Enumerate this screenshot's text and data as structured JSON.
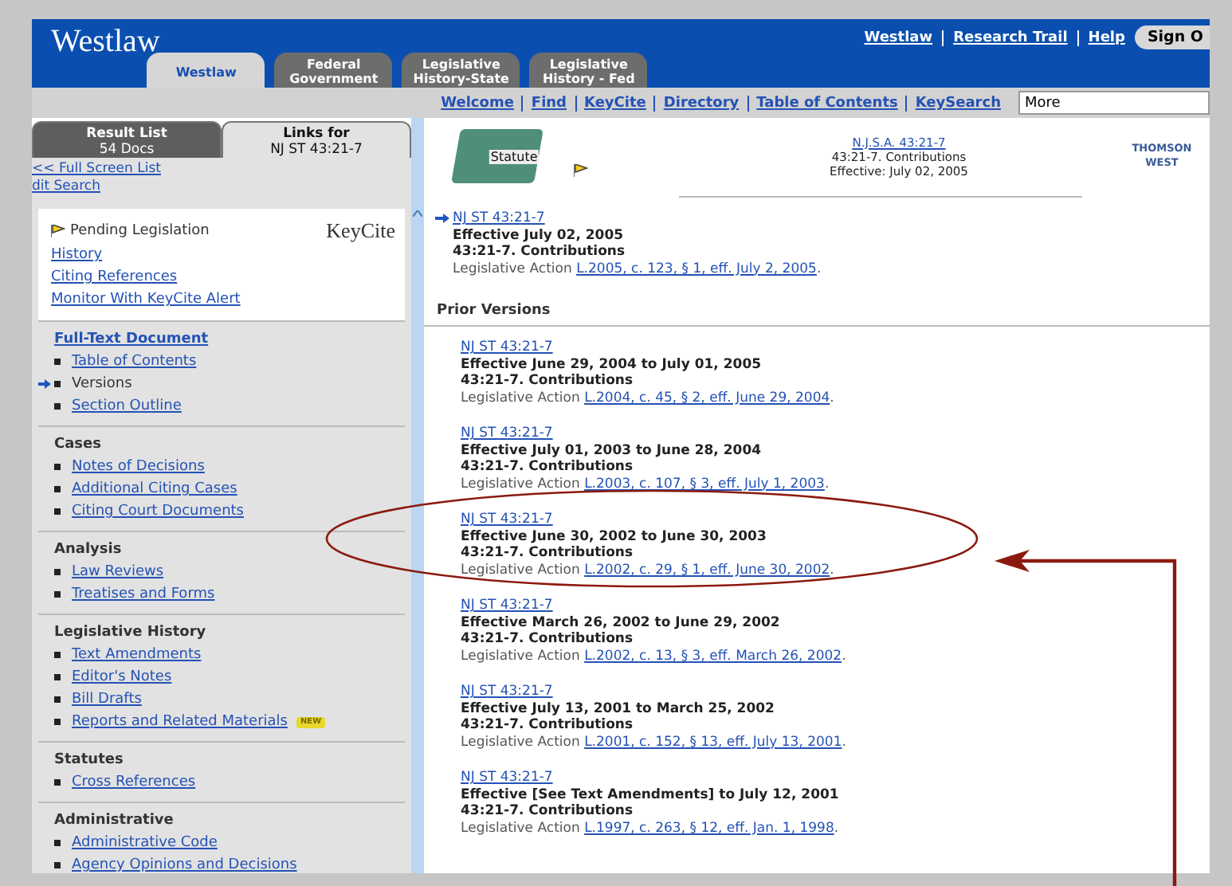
{
  "header": {
    "logo": "Westlaw",
    "top_links": [
      "Westlaw",
      "Research Trail",
      "Help"
    ],
    "sign_button": "Sign O",
    "tabs": [
      {
        "label": "Westlaw",
        "selected": true
      },
      {
        "label": "Federal Government",
        "selected": false
      },
      {
        "label": "Legislative History-State",
        "selected": false
      },
      {
        "label": "Legislative History - Fed",
        "selected": false
      }
    ]
  },
  "nav": {
    "links": [
      "Welcome",
      "Find",
      "KeyCite",
      "Directory",
      "Table of Contents",
      "KeySearch"
    ],
    "more_field": {
      "value": "More"
    }
  },
  "left_tabs": [
    {
      "title": "Result List",
      "subtitle": "54 Docs",
      "selected": false
    },
    {
      "title": "Links for",
      "subtitle": "NJ ST 43:21-7",
      "selected": true
    }
  ],
  "left_links": [
    "<< Full Screen List",
    "dit Search"
  ],
  "keycite": {
    "status": "Pending Legislation",
    "logo": "KeyCite",
    "links": [
      "History",
      "Citing References",
      "Monitor With KeyCite Alert"
    ]
  },
  "sections": [
    {
      "heading": "Full-Text Document",
      "heading_link": true,
      "items": [
        {
          "label": "Table of Contents",
          "selected": false
        },
        {
          "label": "Versions",
          "selected": true
        },
        {
          "label": "Section Outline",
          "selected": false
        }
      ]
    },
    {
      "heading": "Cases",
      "heading_link": false,
      "items": [
        {
          "label": "Notes of Decisions",
          "selected": false
        },
        {
          "label": "Additional Citing Cases",
          "selected": false
        },
        {
          "label": "Citing Court Documents",
          "selected": false
        }
      ]
    },
    {
      "heading": "Analysis",
      "heading_link": false,
      "items": [
        {
          "label": "Law Reviews",
          "selected": false
        },
        {
          "label": "Treatises and Forms",
          "selected": false
        }
      ]
    },
    {
      "heading": "Legislative History",
      "heading_link": false,
      "items": [
        {
          "label": "Text Amendments",
          "selected": false
        },
        {
          "label": "Editor's Notes",
          "selected": false
        },
        {
          "label": "Bill Drafts",
          "selected": false
        },
        {
          "label": "Reports and Related Materials",
          "selected": false,
          "badge": "NEW"
        }
      ]
    },
    {
      "heading": "Statutes",
      "heading_link": false,
      "items": [
        {
          "label": "Cross References",
          "selected": false
        }
      ]
    },
    {
      "heading": "Administrative",
      "heading_link": false,
      "items": [
        {
          "label": "Administrative Code",
          "selected": false
        },
        {
          "label": "Agency Opinions and Decisions",
          "selected": false
        }
      ]
    }
  ],
  "doc_header": {
    "book_label": "Statute",
    "citation": "N.J.S.A. 43:21-7",
    "title": "43:21-7. Contributions",
    "effective": "Effective: July 02, 2005",
    "publisher": [
      "THOMSON",
      "WEST"
    ]
  },
  "current_version": {
    "citation": "NJ ST 43:21-7",
    "effective": "Effective July 02, 2005",
    "title": "43:21-7. Contributions",
    "action_label": "Legislative Action",
    "action": "L.2005, c. 123, § 1, eff. July 2, 2005",
    "punct": "."
  },
  "prior_heading": "Prior Versions",
  "prior_versions": [
    {
      "citation": "NJ ST 43:21-7",
      "effective": "Effective June 29, 2004 to July 01, 2005",
      "title": "43:21-7. Contributions",
      "action_label": "Legislative Action",
      "action": "L.2004, c. 45, § 2, eff. June 29, 2004",
      "punct": ".",
      "annotated": false
    },
    {
      "citation": "NJ ST 43:21-7",
      "effective": "Effective July 01, 2003 to June 28, 2004",
      "title": "43:21-7. Contributions",
      "action_label": "Legislative Action",
      "action": "L.2003, c. 107, § 3, eff. July 1, 2003",
      "punct": ".",
      "annotated": false
    },
    {
      "citation": "NJ ST 43:21-7",
      "effective": "Effective June 30, 2002 to June 30, 2003",
      "title": "43:21-7. Contributions",
      "action_label": "Legislative Action",
      "action": "L.2002, c. 29, § 1, eff. June 30, 2002",
      "punct": ".",
      "annotated": true
    },
    {
      "citation": "NJ ST 43:21-7",
      "effective": "Effective March 26, 2002 to June 29, 2002",
      "title": "43:21-7. Contributions",
      "action_label": "Legislative Action",
      "action": "L.2002, c. 13, § 3, eff. March 26, 2002",
      "punct": ".",
      "annotated": false
    },
    {
      "citation": "NJ ST 43:21-7",
      "effective": "Effective July 13, 2001 to March 25, 2002",
      "title": "43:21-7. Contributions",
      "action_label": "Legislative Action",
      "action": "L.2001, c. 152, § 13, eff. July 13, 2001",
      "punct": ".",
      "annotated": false
    },
    {
      "citation": "NJ ST 43:21-7",
      "effective": "Effective [See Text Amendments] to July 12, 2001",
      "title": "43:21-7. Contributions",
      "action_label": "Legislative Action",
      "action": "L.1997, c. 263, § 12, eff. Jan. 1, 1998",
      "punct": ".",
      "annotated": false
    }
  ]
}
